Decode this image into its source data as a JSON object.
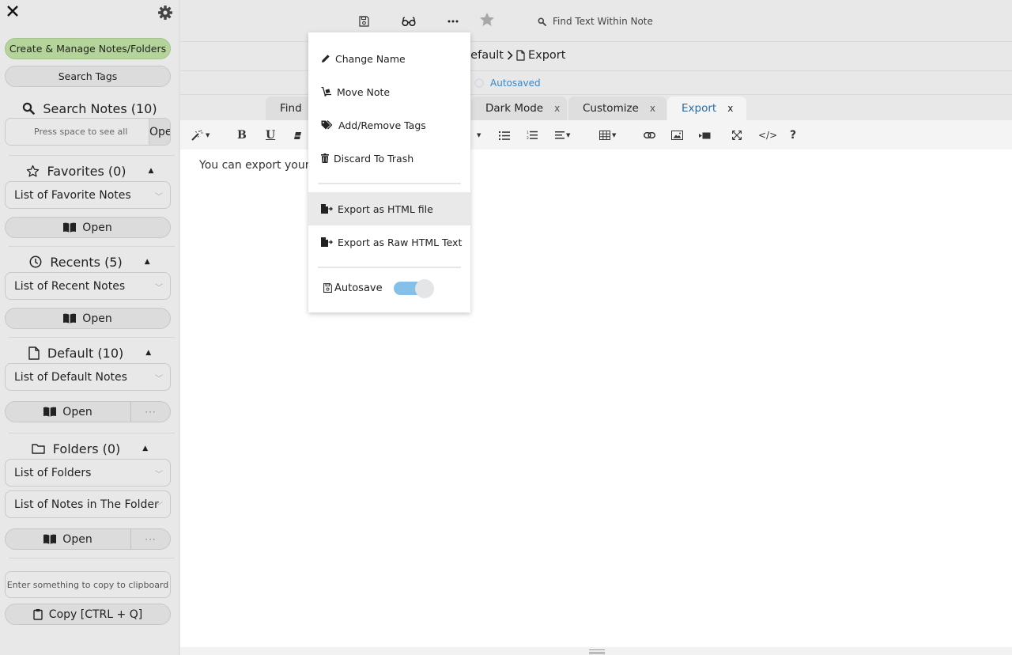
{
  "sidebar": {
    "create_manage_label": "Create & Manage Notes/Folders",
    "search_tags_label": "Search Tags",
    "search_notes": {
      "title": "Search Notes (10)",
      "placeholder": "Press space to see all",
      "open_label": "Open"
    },
    "favorites": {
      "title": "Favorites (0)",
      "select_value": "List of Favorite Notes",
      "open_label": "Open"
    },
    "recents": {
      "title": "Recents (5)",
      "select_value": "List of Recent Notes",
      "open_label": "Open"
    },
    "default": {
      "title": "Default (10)",
      "select_value": "List of Default Notes",
      "open_label": "Open",
      "more_label": "···"
    },
    "folders": {
      "title": "Folders (0)",
      "select_folders_value": "List of Folders",
      "select_notes_value": "List of Notes in The Folder",
      "open_label": "Open",
      "more_label": "···"
    },
    "clipboard": {
      "placeholder": "Enter something to copy to clipboard",
      "copy_label": "Copy [CTRL + Q]"
    },
    "caret": "▲"
  },
  "topbar": {
    "find_placeholder": "Find Text Within Note",
    "more_label": "···"
  },
  "breadcrumb": {
    "folder": "Default",
    "separator": ">",
    "note": "Export"
  },
  "status": {
    "text": "Autosaved",
    "color": "#3a87c8"
  },
  "tabs": [
    {
      "label": "Find",
      "close": "x",
      "active": false
    },
    {
      "label": "Dark Mode",
      "close": "x",
      "active": false
    },
    {
      "label": "Customize",
      "close": "x",
      "active": false
    },
    {
      "label": "Export",
      "close": "x",
      "active": true
    }
  ],
  "toolbar": {
    "bold": "B",
    "underline": "U",
    "code_view": "</>",
    "help": "?"
  },
  "editor": {
    "text": "You can export your note"
  },
  "menu": {
    "items": [
      {
        "label": "Change Name",
        "icon": "pencil-icon"
      },
      {
        "label": "Move Note",
        "icon": "dolly-icon"
      },
      {
        "label": "Add/Remove Tags",
        "icon": "tags-icon"
      },
      {
        "label": "Discard To Trash",
        "icon": "trash-icon"
      },
      {
        "label": "Export as HTML file",
        "icon": "file-export-icon",
        "hover": true
      },
      {
        "label": "Export as Raw HTML Text",
        "icon": "file-export-icon"
      }
    ],
    "autosave_label": "Autosave",
    "autosave_on": true
  },
  "colors": {
    "accent_green": "#b4d49c",
    "active_tab_text": "#2b6ca3",
    "toggle_on": "#85c0e9"
  }
}
